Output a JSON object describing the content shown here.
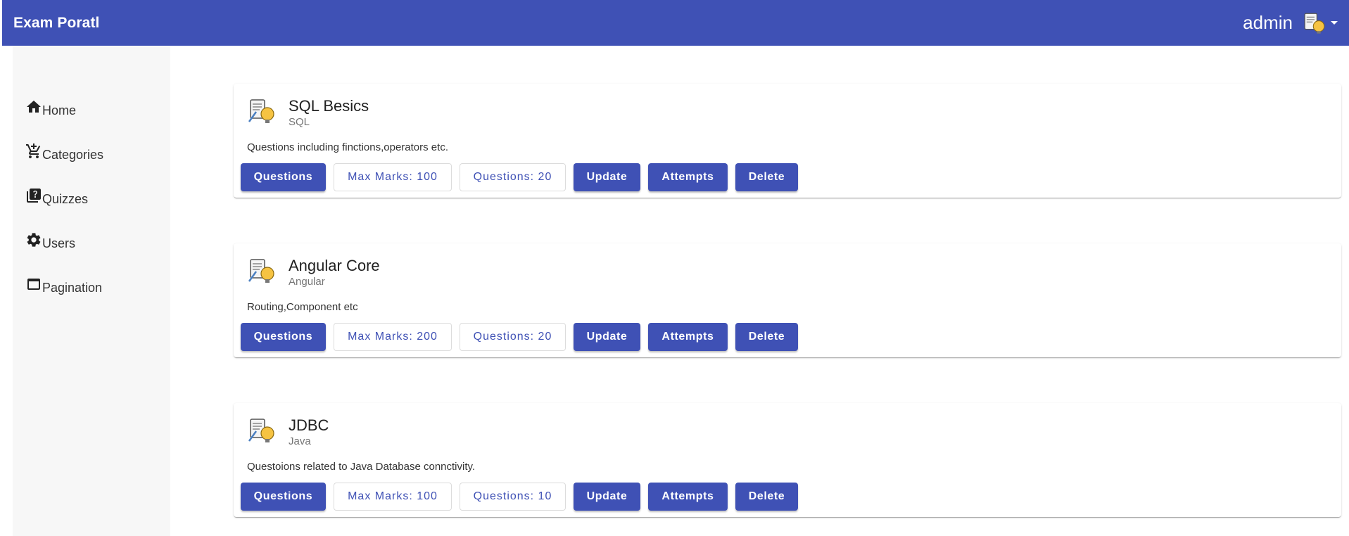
{
  "header": {
    "brand": "Exam Poratl",
    "user_name": "admin",
    "avatar_icon": "quiz-bulb-avatar-icon",
    "dropdown_icon": "caret-down-icon"
  },
  "sidebar": {
    "items": [
      {
        "label": "Home",
        "icon": "home-icon"
      },
      {
        "label": "Categories",
        "icon": "add-shopping-cart-icon"
      },
      {
        "label": "Quizzes",
        "icon": "quiz-icon"
      },
      {
        "label": "Users",
        "icon": "gear-icon"
      },
      {
        "label": "Pagination",
        "icon": "web-asset-icon"
      }
    ]
  },
  "quizzes": [
    {
      "title": "SQL Besics",
      "category": "SQL",
      "description": "Questions including finctions,operators etc.",
      "questions_label": "Questions",
      "max_marks": "Max Marks: 100",
      "question_count": "Questions: 20",
      "update_label": "Update",
      "attempts_label": "Attempts",
      "delete_label": "Delete"
    },
    {
      "title": "Angular Core",
      "category": "Angular",
      "description": "Routing,Component etc",
      "questions_label": "Questions",
      "max_marks": "Max Marks: 200",
      "question_count": "Questions: 20",
      "update_label": "Update",
      "attempts_label": "Attempts",
      "delete_label": "Delete"
    },
    {
      "title": "JDBC",
      "category": "Java",
      "description": "Questoions related to Java Database connctivity.",
      "questions_label": "Questions",
      "max_marks": "Max Marks: 100",
      "question_count": "Questions: 10",
      "update_label": "Update",
      "attempts_label": "Attempts",
      "delete_label": "Delete"
    }
  ],
  "colors": {
    "primary": "#3f51b5",
    "sidebar_bg": "#f7f7f7"
  }
}
